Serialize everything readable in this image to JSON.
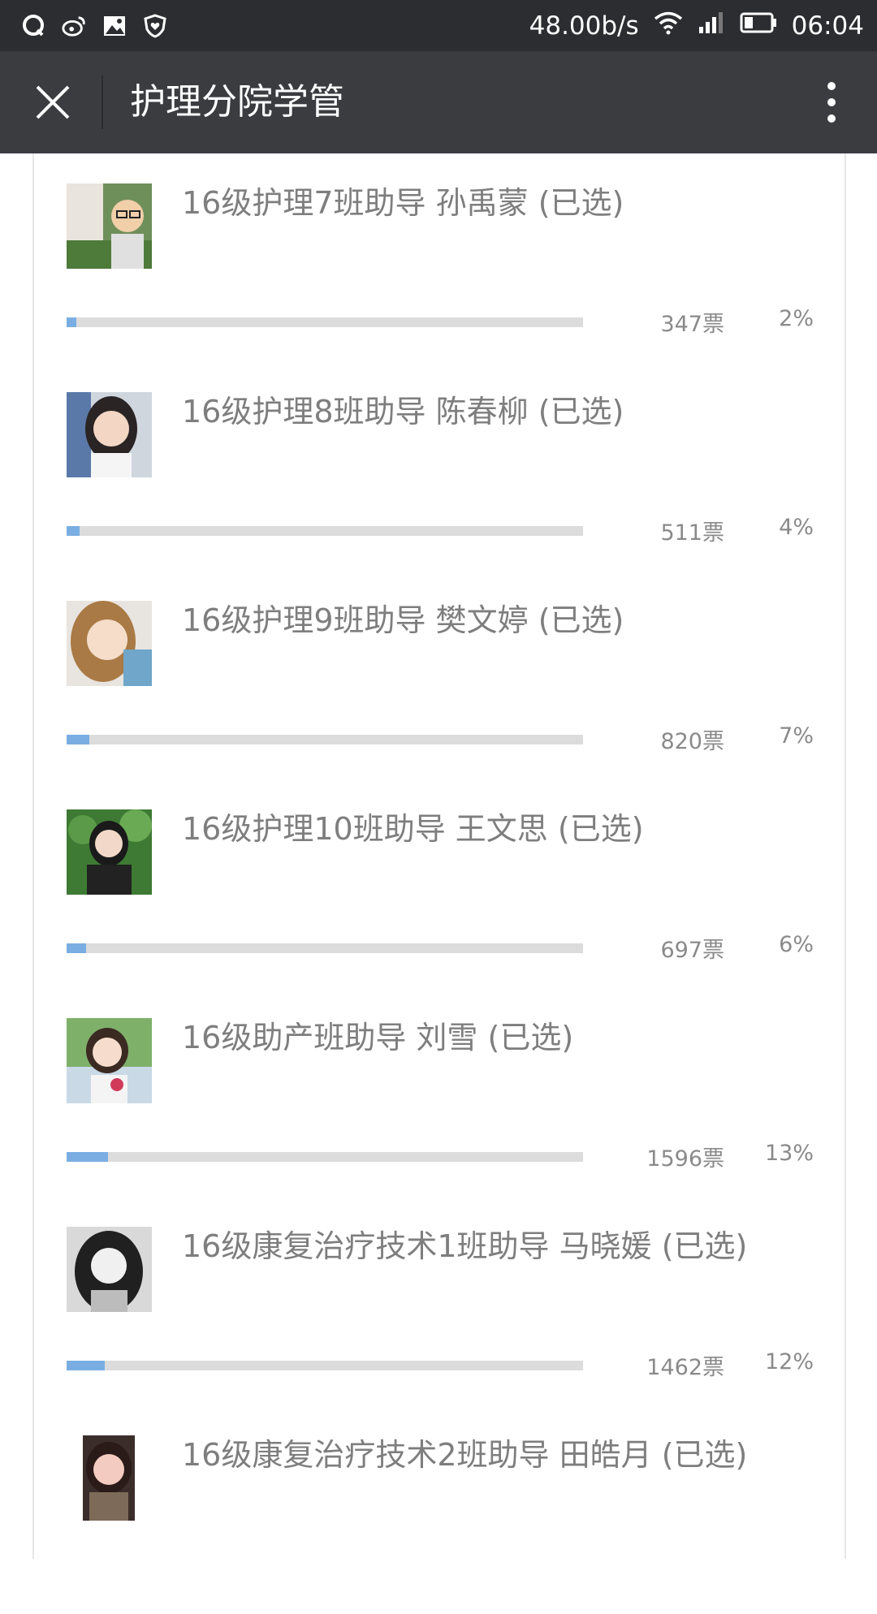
{
  "status_bar": {
    "net_speed": "48.00b/s",
    "time": "06:04",
    "left_icons": [
      "qq-icon",
      "weibo-icon",
      "image-icon",
      "shield-heart-icon"
    ],
    "right_icons": [
      "wifi-icon",
      "signal-icon",
      "battery-icon"
    ]
  },
  "app_bar": {
    "title": "护理分院学管",
    "close_icon": "close-icon",
    "more_icon": "more-vertical-icon"
  },
  "colors": {
    "status_bar_bg": "#2c2d30",
    "app_bar_bg": "#3a3c40",
    "bar_fill": "#7aaee2",
    "bar_track": "#dcdcdc",
    "text": "#7e7e7e"
  },
  "items": [
    {
      "name": "16级护理7班助导 孙禹蒙 (已选)",
      "votes": "347票",
      "percent": "2%",
      "share": 0.02
    },
    {
      "name": "16级护理8班助导 陈春柳 (已选)",
      "votes": "511票",
      "percent": "4%",
      "share": 0.04
    },
    {
      "name": "16级护理9班助导 樊文婷 (已选)",
      "votes": "820票",
      "percent": "7%",
      "share": 0.07
    },
    {
      "name": "16级护理10班助导 王文思 (已选)",
      "votes": "697票",
      "percent": "6%",
      "share": 0.06
    },
    {
      "name": "16级助产班助导 刘雪 (已选)",
      "votes": "1596票",
      "percent": "13%",
      "share": 0.13
    },
    {
      "name": "16级康复治疗技术1班助导 马晓媛 (已选)",
      "votes": "1462票",
      "percent": "12%",
      "share": 0.12
    },
    {
      "name": "16级康复治疗技术2班助导 田皓月 (已选)",
      "votes": "",
      "percent": "",
      "share": null
    }
  ]
}
